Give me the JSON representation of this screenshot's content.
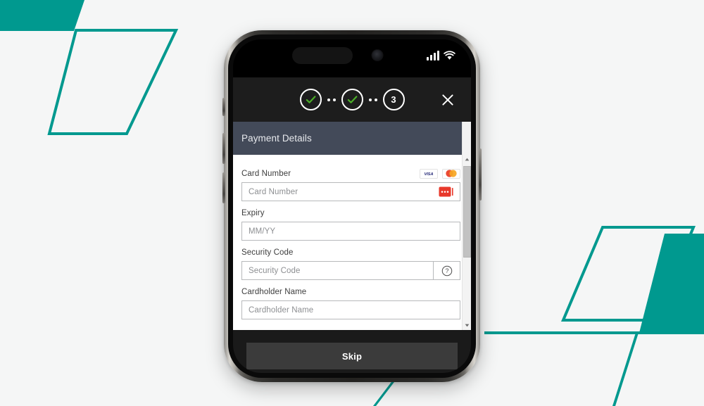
{
  "theme": {
    "accent_teal": "#00998f",
    "page_background": "#f5f6f6",
    "sheet_header": "#434a59",
    "stepper_bar": "#1d1d1d",
    "footer_bar": "#1a1a1a",
    "skip_button": "#3b3b3b",
    "check_green": "#4caf28",
    "card_icon_red": "#e8392b",
    "mastercard_red": "#eb4a33",
    "mastercard_orange": "#f6a623",
    "visa_blue": "#1a1f71",
    "input_border": "#b7b9bb",
    "placeholder_text": "#8d8f92"
  },
  "phone": {
    "status_bar": {
      "dynamic_island": "dynamic-island",
      "camera": "front-camera-dot",
      "signal_icon": "signal-bars-icon",
      "signal_bars": 4,
      "wifi_icon": "wifi-icon"
    }
  },
  "stepper": {
    "steps": [
      {
        "id": "step-1",
        "state": "complete",
        "icon": "check-icon",
        "label": ""
      },
      {
        "id": "step-2",
        "state": "complete",
        "icon": "check-icon",
        "label": ""
      },
      {
        "id": "step-3",
        "state": "current",
        "icon": "",
        "label": "3"
      }
    ],
    "close_icon": "close-icon"
  },
  "sheet": {
    "title": "Payment Details",
    "scrollbar": {
      "up_icon": "chevron-up-icon",
      "down_icon": "chevron-down-icon",
      "thumb": "scrollbar-thumb"
    },
    "fields": [
      {
        "id": "card-number",
        "label": "Card Number",
        "placeholder": "Card Number",
        "value": "",
        "brand_icons": [
          "visa-icon",
          "mastercard-icon"
        ],
        "inline_icon": "card-dots-icon",
        "addon": null
      },
      {
        "id": "expiry",
        "label": "Expiry",
        "placeholder": "MM/YY",
        "value": "",
        "brand_icons": [],
        "inline_icon": null,
        "addon": null
      },
      {
        "id": "security-code",
        "label": "Security Code",
        "placeholder": "Security Code",
        "value": "",
        "brand_icons": [],
        "inline_icon": null,
        "addon": "help-question-icon"
      },
      {
        "id": "cardholder-name",
        "label": "Cardholder Name",
        "placeholder": "Cardholder Name",
        "value": "",
        "brand_icons": [],
        "inline_icon": null,
        "addon": null
      }
    ]
  },
  "footer": {
    "skip_label": "Skip"
  }
}
